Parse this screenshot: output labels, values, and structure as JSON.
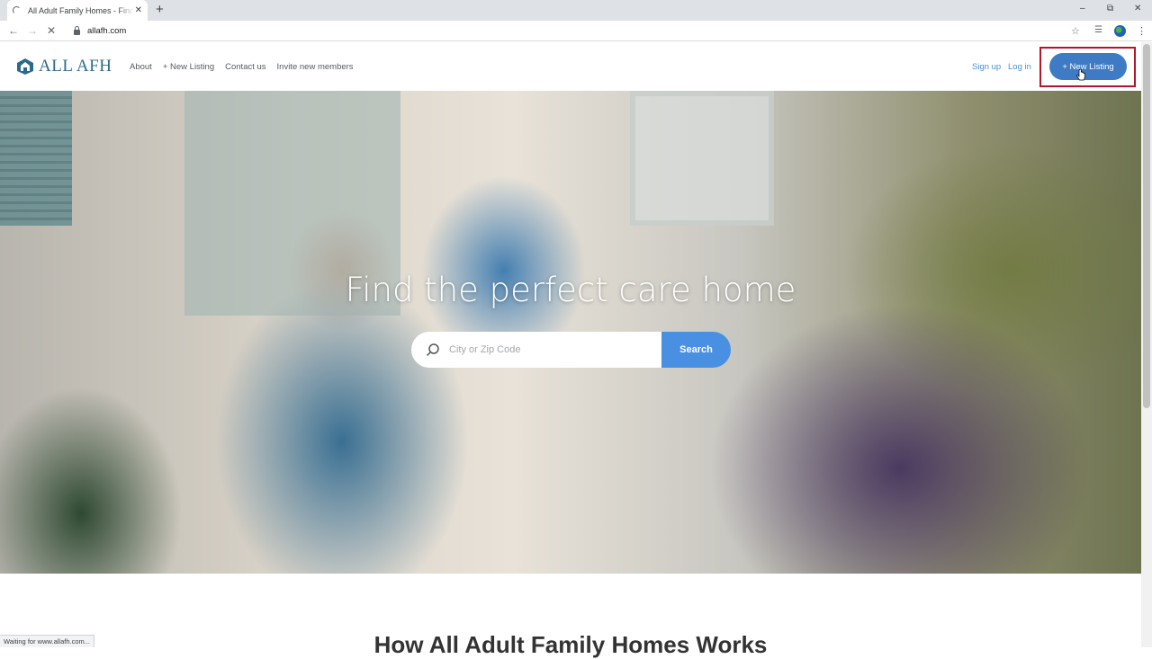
{
  "browser": {
    "tab_title": "All Adult Family Homes - Find the perfect care home",
    "tab_close": "✕",
    "new_tab": "+",
    "url": "allafh.com",
    "status_text": "Waiting for www.allafh.com..."
  },
  "header": {
    "logo_text": "ALL AFH",
    "nav": [
      "About",
      "+ New Listing",
      "Contact us",
      "Invite new members"
    ],
    "sign_up": "Sign up",
    "log_in": "Log in",
    "cta_label": "+ New Listing"
  },
  "hero": {
    "heading": "Find the perfect care home",
    "search_placeholder": "City or Zip Code",
    "search_button": "Search"
  },
  "section": {
    "heading": "How All Adult Family Homes Works"
  },
  "colors": {
    "brand": "#2b6a8a",
    "cta": "#3e7bc4",
    "search_button": "#4a90e2",
    "highlight_frame": "#b3152a"
  }
}
